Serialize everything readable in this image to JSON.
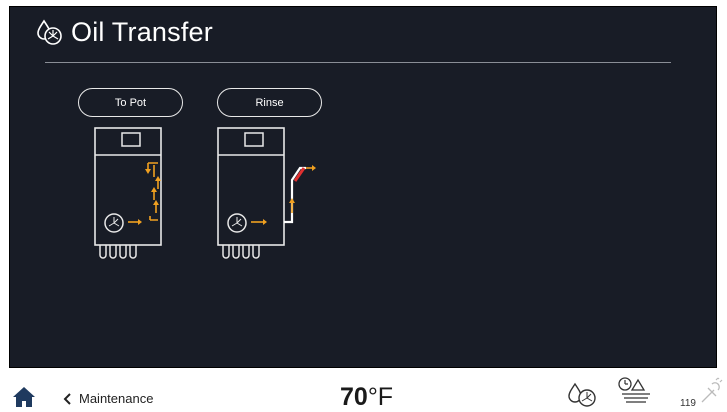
{
  "header": {
    "title": "Oil Transfer",
    "title_icon": "oil-drop-fan-icon"
  },
  "buttons": {
    "to_pot": "To Pot",
    "rinse": "Rinse"
  },
  "diagrams": [
    {
      "name": "to-pot-flow-diagram",
      "icon": "fryer-to-pot-icon"
    },
    {
      "name": "rinse-flow-diagram",
      "icon": "fryer-rinse-icon"
    }
  ],
  "footer": {
    "back_label": "Maintenance",
    "temperature": "70",
    "temperature_unit": "°F",
    "status_count": "119"
  },
  "colors": {
    "accent": "#f0a020",
    "screen_bg": "#181c26",
    "valve_red": "#e03030"
  }
}
